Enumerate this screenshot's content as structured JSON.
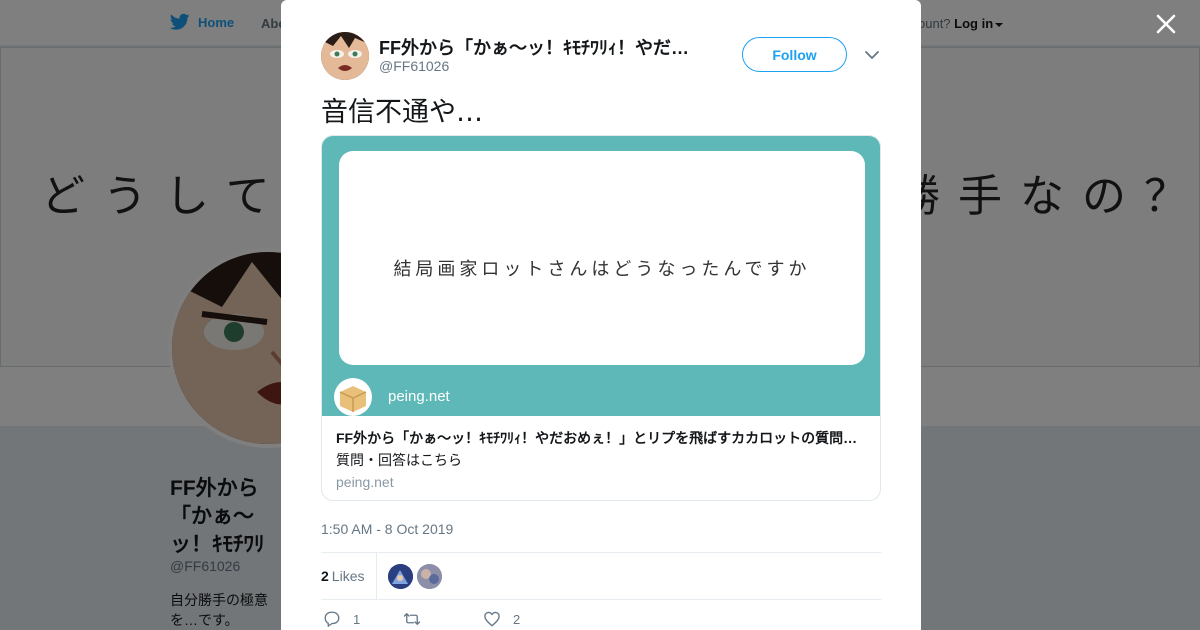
{
  "nav": {
    "home_label": "Home",
    "about_label": "Abo",
    "account_prompt": "ccount?",
    "login_label": "Log in"
  },
  "banner": {
    "left_text": "どうしてお",
    "right_text": "勝手なの？"
  },
  "profile": {
    "name": "FF外から「かぁ〜ッ！ｷﾓﾁﾜﾘｨ！やだおめぇ！」とリプを飛ばす",
    "handle": "@FF61026",
    "bio": "自分勝手の極意を…です。"
  },
  "tweet": {
    "author_name": "FF外から「かぁ〜ッ！ｷﾓﾁﾜﾘｨ！やだ…",
    "author_handle": "@FF61026",
    "follow_label": "Follow",
    "text": "音信不通や…",
    "card": {
      "question": "結局画家ロットさんはどうなったんですか",
      "brand_domain": "peing.net",
      "title": "FF外から「かぁ〜ッ！ｷﾓﾁﾜﾘｨ！やだおめぇ！」とリプを飛ばすカカロットの質問…",
      "description": "質問・回答はこちら",
      "url": "peing.net"
    },
    "timestamp": "1:50 AM - 8 Oct 2019",
    "likes_count": "2",
    "likes_label": "Likes",
    "reply_count": "1",
    "retweet_count": "",
    "like_count": "2"
  },
  "icons": {
    "close": "close-icon",
    "bird": "twitter-bird-icon",
    "chevron": "chevron-down-icon",
    "reply": "reply-icon",
    "retweet": "retweet-icon",
    "like": "heart-icon"
  },
  "colors": {
    "brand": "#1da1f2",
    "card_teal": "#5eb8b8",
    "muted": "#657786"
  }
}
